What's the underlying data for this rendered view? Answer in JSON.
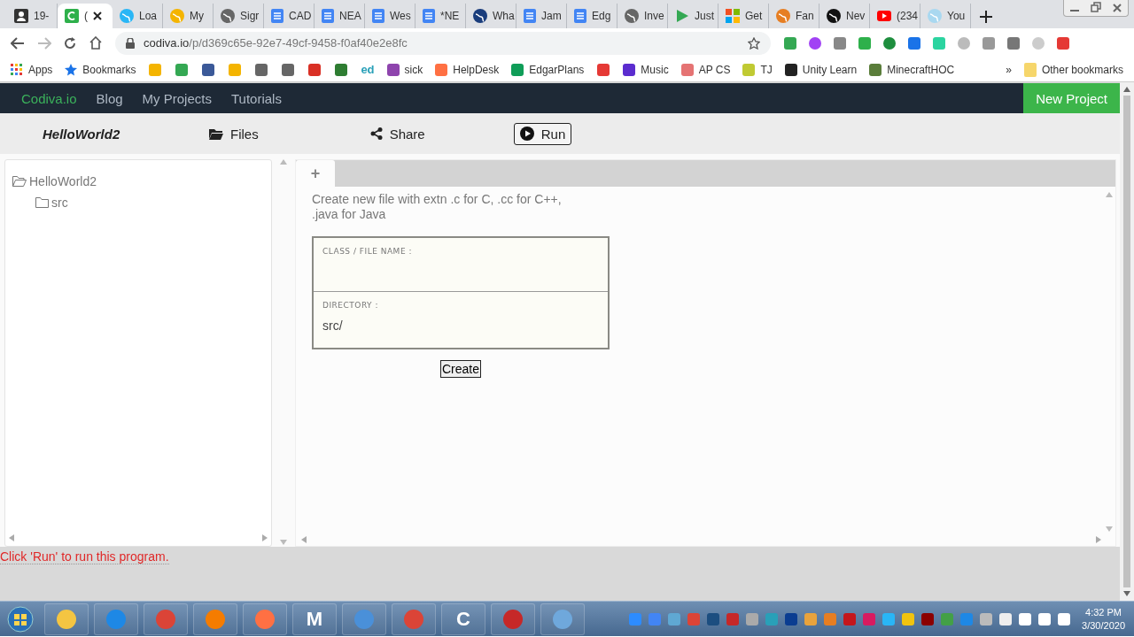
{
  "browser": {
    "tabs": [
      {
        "label": "19-",
        "selected": false
      },
      {
        "label": "(",
        "selected": true
      },
      {
        "label": "Loa",
        "selected": false
      },
      {
        "label": "My",
        "selected": false
      },
      {
        "label": "Sigr",
        "selected": false
      },
      {
        "label": "CAD",
        "selected": false
      },
      {
        "label": "NEA",
        "selected": false
      },
      {
        "label": "Wes",
        "selected": false
      },
      {
        "label": "*NE",
        "selected": false
      },
      {
        "label": "Wha",
        "selected": false
      },
      {
        "label": "Jam",
        "selected": false
      },
      {
        "label": "Edg",
        "selected": false
      },
      {
        "label": "Inve",
        "selected": false
      },
      {
        "label": "Just",
        "selected": false
      },
      {
        "label": "Get",
        "selected": false
      },
      {
        "label": "Fan",
        "selected": false
      },
      {
        "label": "Nev",
        "selected": false
      },
      {
        "label": "(234",
        "selected": false
      },
      {
        "label": "You",
        "selected": false
      }
    ],
    "address": {
      "host": "codiva.io",
      "path": "/p/d369c65e-92e7-49cf-9458-f0af40e2e8fc"
    },
    "bookmarks": [
      {
        "kind": "link",
        "label": "Apps"
      },
      {
        "kind": "link",
        "label": "Bookmarks"
      },
      {
        "kind": "icon"
      },
      {
        "kind": "icon"
      },
      {
        "kind": "icon"
      },
      {
        "kind": "icon"
      },
      {
        "kind": "icon"
      },
      {
        "kind": "icon"
      },
      {
        "kind": "icon"
      },
      {
        "kind": "icon"
      },
      {
        "kind": "logo",
        "label": "ed"
      },
      {
        "kind": "link",
        "label": "sick"
      },
      {
        "kind": "link",
        "label": "HelpDesk"
      },
      {
        "kind": "link",
        "label": "EdgarPlans"
      },
      {
        "kind": "icon"
      },
      {
        "kind": "link",
        "label": "Music"
      },
      {
        "kind": "link",
        "label": "AP CS"
      },
      {
        "kind": "link",
        "label": "TJ"
      },
      {
        "kind": "link",
        "label": "Unity Learn"
      },
      {
        "kind": "link",
        "label": "MinecraftHOC"
      }
    ],
    "bookmarks_overflow": "»",
    "other_bookmarks": "Other bookmarks"
  },
  "app": {
    "brand": "Codiva.io",
    "nav": [
      "Blog",
      "My Projects",
      "Tutorials"
    ],
    "new_project": "New Project",
    "toolbar": {
      "project": "HelloWorld2",
      "files": "Files",
      "share": "Share",
      "run": "Run"
    },
    "tree": [
      {
        "label": "HelloWorld2",
        "children": [
          {
            "label": "src"
          }
        ]
      }
    ],
    "editor": {
      "new_tab": "+",
      "hint": "Create new file with extn .c for C, .cc for C++, .java for Java",
      "fields": [
        {
          "label": "CLASS / FILE NAME :"
        },
        {
          "label": "DIRECTORY :",
          "value": "src/"
        }
      ],
      "create": "Create"
    },
    "status": "Click 'Run' to run this program."
  },
  "taskbar": {
    "apps": [
      {
        "kind": "icon"
      },
      {
        "kind": "icon"
      },
      {
        "kind": "icon"
      },
      {
        "kind": "icon"
      },
      {
        "kind": "icon"
      },
      {
        "kind": "letter",
        "glyph": "M"
      },
      {
        "kind": "icon"
      },
      {
        "kind": "icon"
      },
      {
        "kind": "letter",
        "glyph": "C"
      },
      {
        "kind": "icon"
      },
      {
        "kind": "icon"
      }
    ],
    "time": "4:32 PM",
    "date": "3/30/2020"
  }
}
